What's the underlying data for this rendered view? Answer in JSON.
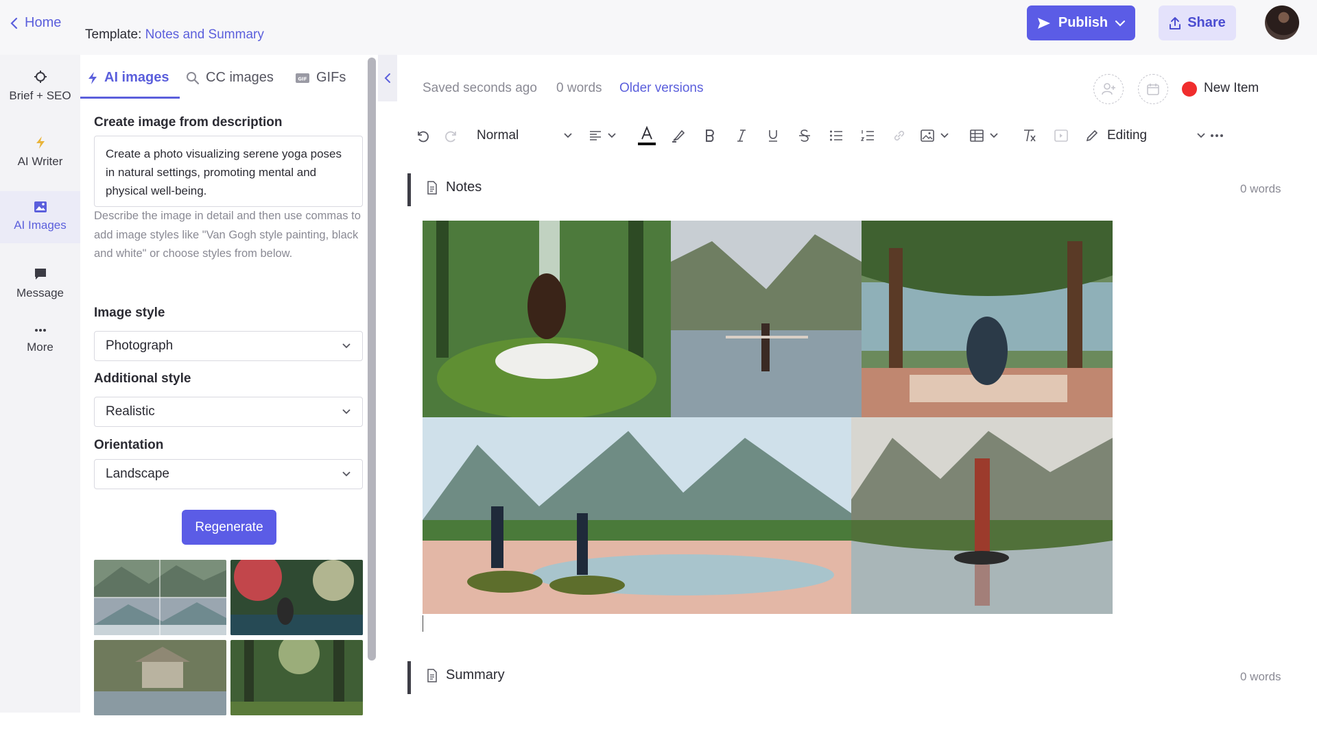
{
  "header": {
    "home_label": "Home",
    "template_prefix": "Template:",
    "template_name": "Notes and Summary",
    "publish_label": "Publish",
    "share_label": "Share"
  },
  "rail": {
    "items": [
      {
        "label": "Brief + SEO",
        "icon": "crosshair-icon"
      },
      {
        "label": "AI Writer",
        "icon": "lightning-icon"
      },
      {
        "label": "AI Images",
        "icon": "image-icon"
      },
      {
        "label": "Message",
        "icon": "chat-icon"
      },
      {
        "label": "More",
        "icon": "ellipsis-icon"
      }
    ],
    "active": "AI Images"
  },
  "panel": {
    "tabs": [
      {
        "label": "AI images",
        "icon": "lightning-icon"
      },
      {
        "label": "CC images",
        "icon": "search-icon"
      },
      {
        "label": "GIFs",
        "icon": "gif-icon"
      }
    ],
    "create_label": "Create image from description",
    "description_value": "Create a photo visualizing serene yoga poses in natural settings, promoting mental and physical well-being.",
    "help_text": "Describe the image in detail and then use commas to add image styles like \"Van Gogh style painting, black and white\" or choose styles from below.",
    "image_style_label": "Image style",
    "image_style_value": "Photograph",
    "additional_style_label": "Additional style",
    "additional_style_value": "Realistic",
    "orientation_label": "Orientation",
    "orientation_value": "Landscape",
    "regenerate_label": "Regenerate"
  },
  "editor": {
    "saved_status": "Saved seconds ago",
    "word_count": "0 words",
    "older_versions": "Older versions",
    "new_item_label": "New Item",
    "toolbar": {
      "text_style": "Normal",
      "mode": "Editing"
    },
    "sections": [
      {
        "title": "Notes",
        "words": "0 words"
      },
      {
        "title": "Summary",
        "words": "0 words"
      }
    ]
  },
  "colors": {
    "accent": "#5b5ce6",
    "status_dot": "#f02d2d"
  }
}
